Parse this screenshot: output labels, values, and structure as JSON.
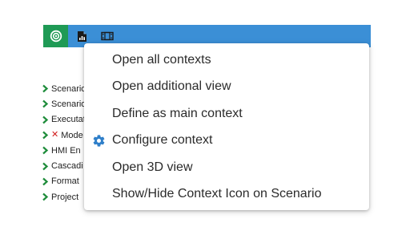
{
  "toolbar": {
    "buttons": [
      {
        "icon": "target-icon",
        "active": true
      },
      {
        "icon": "document-chart-icon"
      },
      {
        "icon": "film-strip-icon"
      }
    ],
    "colors": {
      "bar": "#3b8fd6",
      "active": "#1f9a55"
    }
  },
  "tree": {
    "items": [
      {
        "label": "Scenario",
        "error": false
      },
      {
        "label": "Scenario",
        "error": false
      },
      {
        "label": "Executat",
        "error": false
      },
      {
        "label": "Mode",
        "error": true
      },
      {
        "label": "HMI En",
        "error": false
      },
      {
        "label": "Cascadi",
        "error": false
      },
      {
        "label": "Format",
        "error": false
      },
      {
        "label": "Project",
        "error": false
      }
    ],
    "colors": {
      "chevron": "#1e8c3a",
      "error": "#d11a1a"
    }
  },
  "context_menu": {
    "items": [
      {
        "label": "Open all contexts",
        "icon": ""
      },
      {
        "label": "Open additional view",
        "icon": ""
      },
      {
        "label": "Define as main context",
        "icon": ""
      },
      {
        "label": "Configure context",
        "icon": "gear-icon"
      },
      {
        "label": "Open 3D view",
        "icon": ""
      },
      {
        "label": "Show/Hide Context Icon on Scenario",
        "icon": ""
      }
    ],
    "colors": {
      "gear": "#2f7fc9"
    }
  }
}
